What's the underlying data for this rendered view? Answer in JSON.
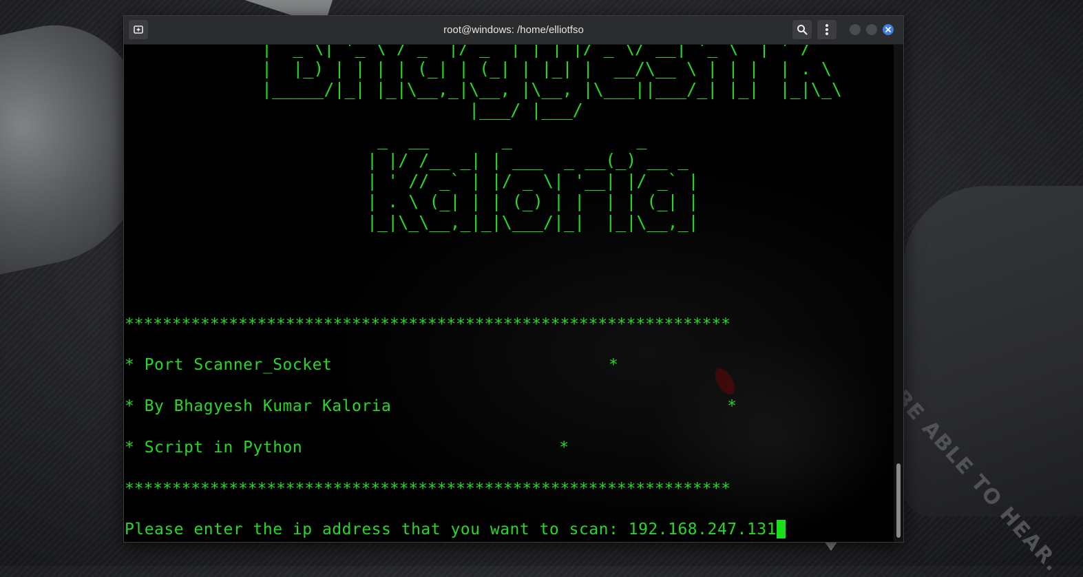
{
  "window": {
    "title": "root@windows: /home/elliotfso"
  },
  "desktop": {
    "wallpaper_text": "BE ABLE TO HEAR."
  },
  "terminal": {
    "ascii_name": " |  _ \\| '_ \\ / _` |/ _` | | | |/ _ \\/ __| '_ \\  | ' /\n |  |_) | | | | (_| | (_| | |_| |  __/\\__ \\ | | |  | . \\\n |_____/|_| |_|\\__,_|\\__, |\\__, |\\___||___/_| |_|  |_|\\_\\\n                     |___/ |___/",
    "ascii_surname": "  _  __       _            _\n | |/ /__ _| | ___  _ __(_) __ _\n | ' // _` | |/ _ \\| '__| |/ _` |\n | . \\ (_| | | (_) | |  | | (_| |\n |_|\\_\\__,_|_|\\___/|_|  |_|\\__,_|",
    "stars_top": "****************************************************************",
    "banner_title": "* Port Scanner_Socket                            *",
    "banner_author": "* By Bhagyesh Kumar Kaloria                                  *",
    "banner_language": "* Script in Python                          *",
    "stars_bottom": "****************************************************************",
    "prompt_text": "Please enter the ip address that you want to scan: ",
    "input_value": "192.168.247.131"
  },
  "colors": {
    "terminal_text": "#27d827",
    "terminal_bg": "#000000",
    "titlebar_bg": "#2b2c2e",
    "close_button": "#3d7ee0"
  },
  "icons": {
    "new_tab": "new-tab-icon",
    "search": "search-icon",
    "menu": "kebab-menu-icon",
    "close": "close-icon"
  }
}
